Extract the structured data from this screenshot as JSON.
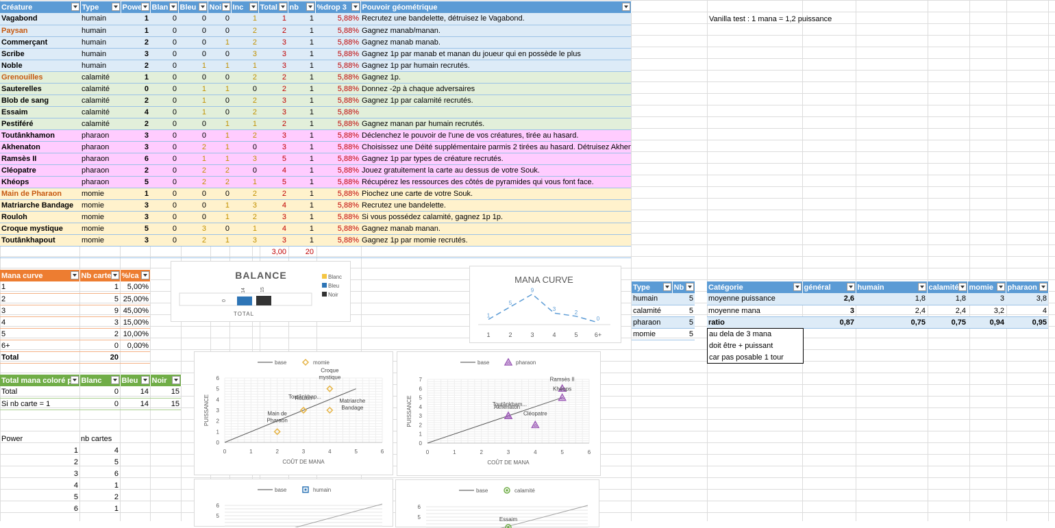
{
  "main_table": {
    "headers": [
      "Créature",
      "Type",
      "Powe",
      "Blan",
      "Bleu",
      "Noi",
      "Inc",
      "Total",
      "nb",
      "%drop 3",
      "Pouvoir géométrique"
    ],
    "rows": [
      {
        "name": "Vagabond",
        "type": "humain",
        "power": "1",
        "blanc": "0",
        "bleu": "0",
        "noir": "0",
        "inc": "1",
        "total": "1",
        "nb": "1",
        "drop": "5,88%",
        "pouvoir": "Recrutez une bandelette, détruisez le Vagabond.",
        "cat": "humain"
      },
      {
        "name": "Paysan",
        "type": "humain",
        "power": "1",
        "blanc": "0",
        "bleu": "0",
        "noir": "0",
        "inc": "2",
        "total": "2",
        "nb": "1",
        "drop": "5,88%",
        "pouvoir": "Gagnez manab/manan.",
        "cat": "humain"
      },
      {
        "name": "Commerçant",
        "type": "humain",
        "power": "2",
        "blanc": "0",
        "bleu": "0",
        "noir": "1",
        "inc": "2",
        "total": "3",
        "nb": "1",
        "drop": "5,88%",
        "pouvoir": "Gagnez manab manab.",
        "cat": "humain"
      },
      {
        "name": "Scribe",
        "type": "humain",
        "power": "3",
        "blanc": "0",
        "bleu": "0",
        "noir": "0",
        "inc": "3",
        "total": "3",
        "nb": "1",
        "drop": "5,88%",
        "pouvoir": "Gagnez 1p par manab et manan du joueur qui en possède le plus",
        "cat": "humain"
      },
      {
        "name": "Noble",
        "type": "humain",
        "power": "2",
        "blanc": "0",
        "bleu": "1",
        "noir": "1",
        "inc": "1",
        "total": "3",
        "nb": "1",
        "drop": "5,88%",
        "pouvoir": "Gagnez 1p par humain recrutés.",
        "cat": "humain"
      },
      {
        "name": "Grenouilles",
        "type": "calamité",
        "power": "1",
        "blanc": "0",
        "bleu": "0",
        "noir": "0",
        "inc": "2",
        "total": "2",
        "nb": "1",
        "drop": "5,88%",
        "pouvoir": "Gagnez 1p.",
        "cat": "calamite"
      },
      {
        "name": "Sauterelles",
        "type": "calamité",
        "power": "0",
        "blanc": "0",
        "bleu": "1",
        "noir": "1",
        "inc": "0",
        "total": "2",
        "nb": "1",
        "drop": "5,88%",
        "pouvoir": "Donnez -2p à chaque adversaires",
        "cat": "calamite"
      },
      {
        "name": "Blob de sang",
        "type": "calamité",
        "power": "2",
        "blanc": "0",
        "bleu": "1",
        "noir": "0",
        "inc": "2",
        "total": "3",
        "nb": "1",
        "drop": "5,88%",
        "pouvoir": "Gagnez 1p par calamité recrutés.",
        "cat": "calamite"
      },
      {
        "name": "Essaim",
        "type": "calamité",
        "power": "4",
        "blanc": "0",
        "bleu": "1",
        "noir": "0",
        "inc": "2",
        "total": "3",
        "nb": "1",
        "drop": "5,88%",
        "pouvoir": "",
        "cat": "calamite"
      },
      {
        "name": "Pestiféré",
        "type": "calamité",
        "power": "2",
        "blanc": "0",
        "bleu": "0",
        "noir": "1",
        "inc": "1",
        "total": "2",
        "nb": "1",
        "drop": "5,88%",
        "pouvoir": "Gagnez manan par humain recrutés.",
        "cat": "calamite"
      },
      {
        "name": "Toutânkhamon",
        "type": "pharaon",
        "power": "3",
        "blanc": "0",
        "bleu": "0",
        "noir": "1",
        "inc": "2",
        "total": "3",
        "nb": "1",
        "drop": "5,88%",
        "pouvoir": "Déclenchez le pouvoir de l'une de vos créatures, tirée au hasard.",
        "cat": "pharaon"
      },
      {
        "name": "Akhenaton",
        "type": "pharaon",
        "power": "3",
        "blanc": "0",
        "bleu": "2",
        "noir": "1",
        "inc": "0",
        "total": "3",
        "nb": "1",
        "drop": "5,88%",
        "pouvoir": "Choisissez une Déité supplémentaire parmis 2 tirées au hasard. Détruisez Akhenaton.",
        "cat": "pharaon"
      },
      {
        "name": "Ramsès II",
        "type": "pharaon",
        "power": "6",
        "blanc": "0",
        "bleu": "1",
        "noir": "1",
        "inc": "3",
        "total": "5",
        "nb": "1",
        "drop": "5,88%",
        "pouvoir": "Gagnez 1p par types de créature recrutés.",
        "cat": "pharaon"
      },
      {
        "name": "Cléopatre",
        "type": "pharaon",
        "power": "2",
        "blanc": "0",
        "bleu": "2",
        "noir": "2",
        "inc": "0",
        "total": "4",
        "nb": "1",
        "drop": "5,88%",
        "pouvoir": "Jouez gratuitement la carte au dessus de votre Souk.",
        "cat": "pharaon"
      },
      {
        "name": "Khéops",
        "type": "pharaon",
        "power": "5",
        "blanc": "0",
        "bleu": "2",
        "noir": "2",
        "inc": "1",
        "total": "5",
        "nb": "1",
        "drop": "5,88%",
        "pouvoir": "Récupérez les ressources des côtés de pyramides qui vous font face.",
        "cat": "pharaon"
      },
      {
        "name": "Main de Pharaon",
        "type": "momie",
        "power": "1",
        "blanc": "0",
        "bleu": "0",
        "noir": "0",
        "inc": "2",
        "total": "2",
        "nb": "1",
        "drop": "5,88%",
        "pouvoir": "Piochez une carte de votre Souk.",
        "cat": "momie"
      },
      {
        "name": "Matriarche Bandage",
        "type": "momie",
        "power": "3",
        "blanc": "0",
        "bleu": "0",
        "noir": "1",
        "inc": "3",
        "total": "4",
        "nb": "1",
        "drop": "5,88%",
        "pouvoir": "Recrutez une bandelette.",
        "cat": "momie"
      },
      {
        "name": "Rouloh",
        "type": "momie",
        "power": "3",
        "blanc": "0",
        "bleu": "0",
        "noir": "1",
        "inc": "2",
        "total": "3",
        "nb": "1",
        "drop": "5,88%",
        "pouvoir": "Si vous possédez calamité, gagnez 1p 1p.",
        "cat": "momie"
      },
      {
        "name": "Croque mystique",
        "type": "momie",
        "power": "5",
        "blanc": "0",
        "bleu": "3",
        "noir": "0",
        "inc": "1",
        "total": "4",
        "nb": "1",
        "drop": "5,88%",
        "pouvoir": "Gagnez manab manan.",
        "cat": "momie"
      },
      {
        "name": "Toutânkhapout",
        "type": "momie",
        "power": "3",
        "blanc": "0",
        "bleu": "2",
        "noir": "1",
        "inc": "3",
        "total": "3",
        "nb": "1",
        "drop": "5,88%",
        "pouvoir": "Gagnez 1p par momie recrutés.",
        "cat": "momie"
      }
    ],
    "total_row": {
      "total": "3,00",
      "nb": "20"
    }
  },
  "vanilla_note": "Vanilla test : 1 mana = 1,2 puissance",
  "mana_curve_table": {
    "headers": [
      "Mana curve",
      "Nb carte",
      "%/ca"
    ],
    "rows": [
      [
        "1",
        "1",
        "5,00%"
      ],
      [
        "2",
        "5",
        "25,00%"
      ],
      [
        "3",
        "9",
        "45,00%"
      ],
      [
        "4",
        "3",
        "15,00%"
      ],
      [
        "5",
        "2",
        "10,00%"
      ],
      [
        "6+",
        "0",
        "0,00%"
      ],
      [
        "Total",
        "20",
        ""
      ]
    ]
  },
  "mana_colore_table": {
    "headers": [
      "Total mana coloré p",
      "Blanc",
      "Bleu",
      "Noir"
    ],
    "rows": [
      [
        "Total",
        "0",
        "14",
        "15"
      ],
      [
        "Si nb carte = 1",
        "0",
        "14",
        "15"
      ]
    ]
  },
  "power_table": {
    "headers": [
      "Power",
      "nb cartes"
    ],
    "rows": [
      [
        "1",
        "4"
      ],
      [
        "2",
        "5"
      ],
      [
        "3",
        "6"
      ],
      [
        "4",
        "1"
      ],
      [
        "5",
        "2"
      ],
      [
        "6",
        "1"
      ]
    ]
  },
  "type_table": {
    "headers": [
      "Type",
      "Nb"
    ],
    "rows": [
      [
        "humain",
        "5"
      ],
      [
        "calamité",
        "5"
      ],
      [
        "pharaon",
        "5"
      ],
      [
        "momie",
        "5"
      ]
    ]
  },
  "category_table": {
    "headers": [
      "Catégorie",
      "général",
      "humain",
      "calamité",
      "momie",
      "pharaon"
    ],
    "rows": [
      [
        "moyenne puissance",
        "2,6",
        "1,8",
        "1,8",
        "3",
        "3,8"
      ],
      [
        "moyenne mana",
        "3",
        "2,4",
        "2,4",
        "3,2",
        "4"
      ],
      [
        "ratio",
        "0,87",
        "0,75",
        "0,75",
        "0,94",
        "0,95"
      ]
    ]
  },
  "note_box": [
    "au dela de 3 mana",
    "doit être + puissant",
    "car pas posable 1 tour"
  ],
  "chart_data": [
    {
      "type": "bar",
      "title": "BALANCE",
      "categories": [
        "TOTAL"
      ],
      "series": [
        {
          "name": "Blanc",
          "values": [
            0
          ],
          "color": "#f4c542"
        },
        {
          "name": "Bleu",
          "values": [
            14
          ],
          "color": "#2e75b6"
        },
        {
          "name": "Noir",
          "values": [
            15
          ],
          "color": "#333333"
        }
      ],
      "xlabel": "TOTAL",
      "legend": "right",
      "data_labels": [
        "0",
        "14",
        "15"
      ]
    },
    {
      "type": "line",
      "title": "MANA CURVE",
      "categories": [
        "1",
        "2",
        "3",
        "4",
        "5",
        "6+"
      ],
      "values": [
        1,
        5,
        9,
        3,
        2,
        0
      ],
      "color": "#5b9bd5",
      "line_style": "dashed"
    },
    {
      "type": "scatter",
      "legend": [
        "base",
        "momie"
      ],
      "xlabel": "COÛT DE MANA",
      "ylabel": "PUISSANCE",
      "xlim": [
        0,
        6
      ],
      "ylim": [
        0,
        6
      ],
      "xticks": [
        "0",
        "1",
        "2",
        "3",
        "4",
        "5",
        "6"
      ],
      "yticks": [
        "0",
        "1",
        "2",
        "3",
        "4",
        "5",
        "6"
      ],
      "base_line": [
        [
          0,
          0
        ],
        [
          5,
          5
        ]
      ],
      "marker": "diamond",
      "color": "#e6b445",
      "points": [
        {
          "x": 2,
          "y": 1,
          "label": "Main de\nPharaon"
        },
        {
          "x": 3,
          "y": 3,
          "label": "Toutânkhap..."
        },
        {
          "x": 3,
          "y": 3,
          "label": "Rouloh"
        },
        {
          "x": 4,
          "y": 5,
          "label": "Croque\nmystique"
        },
        {
          "x": 4,
          "y": 3,
          "label": "Matriarche\nBandage"
        }
      ]
    },
    {
      "type": "scatter",
      "legend": [
        "base",
        "pharaon"
      ],
      "xlabel": "COÛT DE MANA",
      "ylabel": "PUISSANCE",
      "xlim": [
        0,
        6
      ],
      "ylim": [
        0,
        7
      ],
      "xticks": [
        "0",
        "1",
        "2",
        "3",
        "4",
        "5",
        "6"
      ],
      "yticks": [
        "0",
        "1",
        "2",
        "3",
        "4",
        "5",
        "6",
        "7"
      ],
      "base_line": [
        [
          0,
          0
        ],
        [
          5,
          5
        ]
      ],
      "marker": "triangle",
      "color": "#9b59b6",
      "points": [
        {
          "x": 3,
          "y": 3,
          "label": "Toutânkham..."
        },
        {
          "x": 3,
          "y": 3,
          "label": "Akhenaton"
        },
        {
          "x": 5,
          "y": 6,
          "label": "Ramsès II"
        },
        {
          "x": 5,
          "y": 5,
          "label": "Khéops"
        },
        {
          "x": 4,
          "y": 2,
          "label": "Cléopatre"
        }
      ]
    },
    {
      "type": "scatter",
      "legend": [
        "base",
        "humain"
      ],
      "yticks": [
        "6",
        "5"
      ],
      "marker": "square",
      "color": "#2e75b6",
      "points": []
    },
    {
      "type": "scatter",
      "legend": [
        "base",
        "calamité"
      ],
      "yticks": [
        "6",
        "5"
      ],
      "marker": "circle",
      "color": "#70ad47",
      "points": [
        {
          "x": 3,
          "y": 4,
          "label": "Essaim"
        }
      ]
    }
  ]
}
